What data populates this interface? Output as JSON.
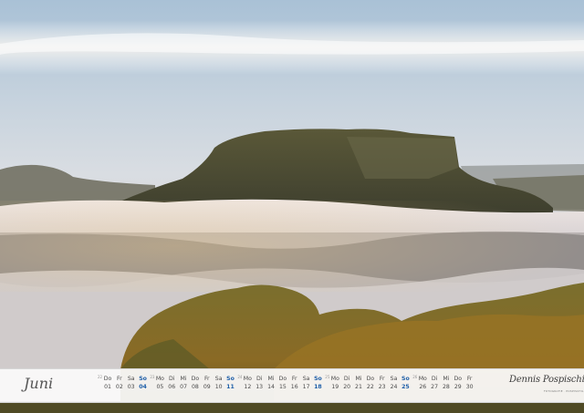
{
  "calendar": {
    "month": "Juni",
    "weeks": [
      {
        "number": "22",
        "days": [
          {
            "name": "Do",
            "date": "01",
            "sunday": false
          },
          {
            "name": "Fr",
            "date": "02",
            "sunday": false
          },
          {
            "name": "Sa",
            "date": "03",
            "sunday": false
          },
          {
            "name": "So",
            "date": "04",
            "sunday": true
          }
        ]
      },
      {
        "number": "23",
        "days": [
          {
            "name": "Mo",
            "date": "05",
            "sunday": false
          },
          {
            "name": "Di",
            "date": "06",
            "sunday": false
          },
          {
            "name": "Mi",
            "date": "07",
            "sunday": false
          },
          {
            "name": "Do",
            "date": "08",
            "sunday": false
          },
          {
            "name": "Fr",
            "date": "09",
            "sunday": false
          },
          {
            "name": "Sa",
            "date": "10",
            "sunday": false
          },
          {
            "name": "So",
            "date": "11",
            "sunday": true
          }
        ]
      },
      {
        "number": "24",
        "days": [
          {
            "name": "Mo",
            "date": "12",
            "sunday": false
          },
          {
            "name": "Di",
            "date": "13",
            "sunday": false
          },
          {
            "name": "Mi",
            "date": "14",
            "sunday": false
          },
          {
            "name": "Do",
            "date": "15",
            "sunday": false
          },
          {
            "name": "Fr",
            "date": "16",
            "sunday": false
          },
          {
            "name": "Sa",
            "date": "17",
            "sunday": false
          },
          {
            "name": "So",
            "date": "18",
            "sunday": true
          }
        ]
      },
      {
        "number": "25",
        "days": [
          {
            "name": "Mo",
            "date": "19",
            "sunday": false
          },
          {
            "name": "Di",
            "date": "20",
            "sunday": false
          },
          {
            "name": "Mi",
            "date": "21",
            "sunday": false
          },
          {
            "name": "Do",
            "date": "22",
            "sunday": false
          },
          {
            "name": "Fr",
            "date": "23",
            "sunday": false
          },
          {
            "name": "Sa",
            "date": "24",
            "sunday": false
          },
          {
            "name": "So",
            "date": "25",
            "sunday": true
          }
        ]
      },
      {
        "number": "26",
        "days": [
          {
            "name": "Mo",
            "date": "26",
            "sunday": false
          },
          {
            "name": "Di",
            "date": "27",
            "sunday": false
          },
          {
            "name": "Mi",
            "date": "28",
            "sunday": false
          },
          {
            "name": "Do",
            "date": "29",
            "sunday": false
          },
          {
            "name": "Fr",
            "date": "30",
            "sunday": false
          }
        ]
      }
    ],
    "sunday_color": "#1f5fa8"
  },
  "signature": {
    "name": "Dennis Pospischil",
    "subtitle": "FOTOGRAFIE · POSPISCHIL"
  },
  "photo": {
    "sky_color": "#aebfd0",
    "fog_color": "#e8e6e8",
    "forest_color": "#6b6a2c"
  }
}
